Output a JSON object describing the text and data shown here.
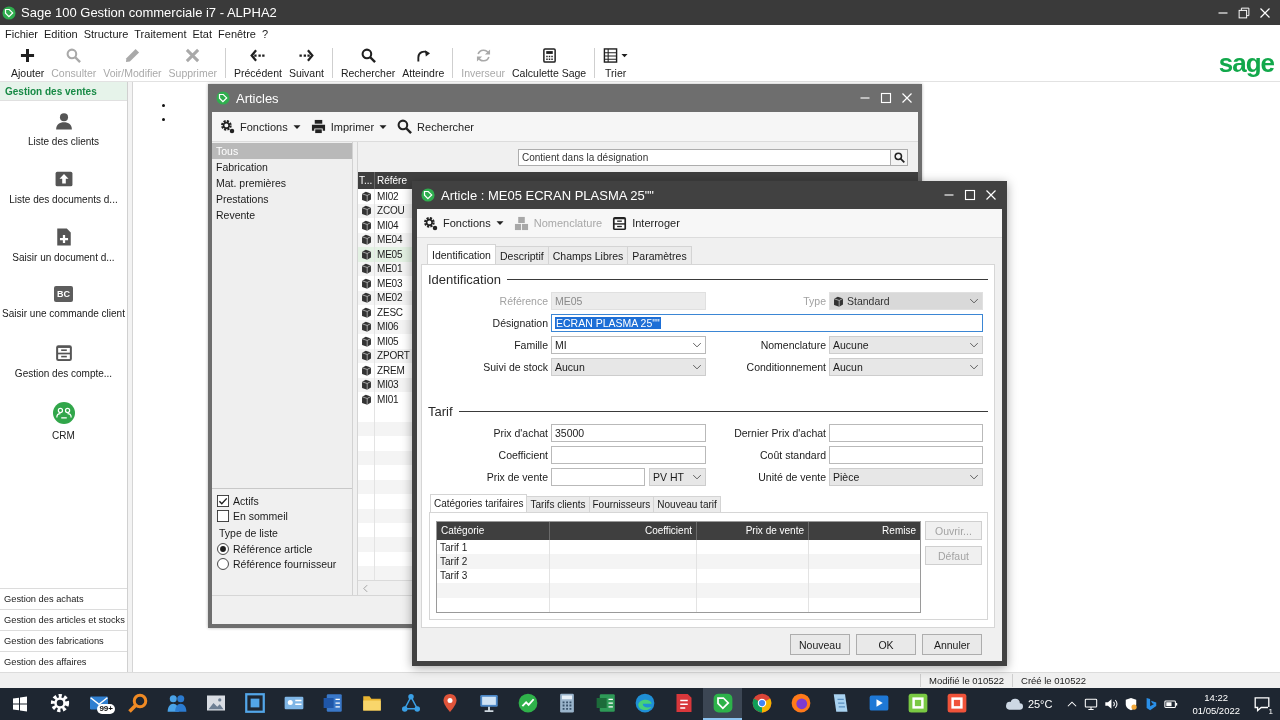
{
  "app": {
    "title": "Sage 100 Gestion commerciale i7 - ALPHA2",
    "logo": "sage"
  },
  "menu": [
    "Fichier",
    "Edition",
    "Structure",
    "Traitement",
    "Etat",
    "Fenêtre",
    "?"
  ],
  "toolbar": [
    [
      {
        "label": "Ajouter",
        "disabled": false,
        "dropdown": false
      },
      {
        "label": "Consulter",
        "disabled": true,
        "dropdown": false
      },
      {
        "label": "Voir/Modifier",
        "disabled": true,
        "dropdown": false
      },
      {
        "label": "Supprimer",
        "disabled": true,
        "dropdown": false
      }
    ],
    [
      {
        "label": "Précédent",
        "disabled": false,
        "dropdown": false
      },
      {
        "label": "Suivant",
        "disabled": false,
        "dropdown": false
      }
    ],
    [
      {
        "label": "Rechercher",
        "disabled": false,
        "dropdown": false
      },
      {
        "label": "Atteindre",
        "disabled": false,
        "dropdown": false
      }
    ],
    [
      {
        "label": "Inverseur",
        "disabled": true,
        "dropdown": false
      },
      {
        "label": "Calculette Sage",
        "disabled": false,
        "dropdown": false
      }
    ],
    [
      {
        "label": "Trier",
        "disabled": false,
        "dropdown": true
      }
    ]
  ],
  "sidebar": {
    "sections": [
      {
        "label": "Gestion des ventes",
        "selected": true,
        "items": [
          {
            "label": "Liste des clients"
          },
          {
            "label": "Liste des documents d..."
          },
          {
            "label": "Saisir un document d..."
          },
          {
            "label": "Saisir une commande client",
            "badge": "BC"
          },
          {
            "label": "Gestion des compte..."
          },
          {
            "label": "CRM"
          }
        ]
      },
      {
        "label": "Gestion des achats",
        "selected": false
      },
      {
        "label": "Gestion des articles et stocks",
        "selected": false
      },
      {
        "label": "Gestion des fabrications",
        "selected": false
      },
      {
        "label": "Gestion des affaires",
        "selected": false
      }
    ]
  },
  "articles_window": {
    "title": "Articles",
    "toolbar": [
      {
        "label": "Fonctions",
        "dropdown": true
      },
      {
        "label": "Imprimer",
        "dropdown": true
      },
      {
        "label": "Rechercher",
        "dropdown": false
      }
    ],
    "families": [
      {
        "label": "Tous",
        "selected": true
      },
      {
        "label": "Fabrication",
        "selected": false
      },
      {
        "label": "Mat. premières",
        "selected": false
      },
      {
        "label": "Prestations",
        "selected": false
      },
      {
        "label": "Revente",
        "selected": false
      }
    ],
    "filters": [
      {
        "label": "Actifs",
        "checked": true
      },
      {
        "label": "En sommeil",
        "checked": false
      }
    ],
    "list_type": {
      "label": "Type de liste",
      "options": [
        {
          "label": "Référence article",
          "selected": true
        },
        {
          "label": "Référence fournisseur",
          "selected": false
        }
      ]
    },
    "search": {
      "placeholder": "Contient dans la désignation"
    },
    "table": {
      "columns": [
        "T...",
        "Référe"
      ],
      "rows": [
        {
          "reference": "MI02",
          "selected": false
        },
        {
          "reference": "ZCOU",
          "selected": false
        },
        {
          "reference": "MI04",
          "selected": false
        },
        {
          "reference": "ME04",
          "selected": false
        },
        {
          "reference": "ME05",
          "selected": true
        },
        {
          "reference": "ME01",
          "selected": false
        },
        {
          "reference": "ME03",
          "selected": false
        },
        {
          "reference": "ME02",
          "selected": false
        },
        {
          "reference": "ZESC",
          "selected": false
        },
        {
          "reference": "MI06",
          "selected": false
        },
        {
          "reference": "MI05",
          "selected": false
        },
        {
          "reference": "ZPORT",
          "selected": false
        },
        {
          "reference": "ZREM",
          "selected": false
        },
        {
          "reference": "MI03",
          "selected": false
        },
        {
          "reference": "MI01",
          "selected": false
        }
      ]
    }
  },
  "article_dialog": {
    "title": "Article : ME05 ECRAN PLASMA 25\"\"",
    "toolbar": [
      {
        "label": "Fonctions",
        "disabled": false,
        "dropdown": true
      },
      {
        "label": "Nomenclature",
        "disabled": true,
        "dropdown": false
      },
      {
        "label": "Interroger",
        "disabled": false,
        "dropdown": false
      }
    ],
    "tabs": [
      {
        "label": "Identification",
        "selected": true
      },
      {
        "label": "Descriptif",
        "selected": false
      },
      {
        "label": "Champs Libres",
        "selected": false
      },
      {
        "label": "Paramètres",
        "selected": false
      }
    ],
    "sections": [
      {
        "title": "Identification",
        "fields": [
          {
            "label": "Référence",
            "kind": "text",
            "value": "ME05",
            "disabled": true,
            "focused": false
          },
          {
            "label": "Type",
            "kind": "item_type",
            "value": "Standard",
            "disabled": true,
            "focused": false
          },
          {
            "label": "Désignation",
            "kind": "long_text",
            "value": "ECRAN PLASMA 25\"\"",
            "disabled": false,
            "focused": true
          },
          {
            "label": "Famille",
            "kind": "combo",
            "value": "MI",
            "disabled": false,
            "focused": false
          },
          {
            "label": "Nomenclature",
            "kind": "select",
            "value": "Aucune",
            "disabled": false,
            "focused": false
          },
          {
            "label": "Suivi de stock",
            "kind": "select",
            "value": "Aucun",
            "disabled": false,
            "focused": false
          },
          {
            "label": "Conditionnement",
            "kind": "select",
            "value": "Aucun",
            "disabled": false,
            "focused": false
          }
        ]
      },
      {
        "title": "Tarif",
        "fields": [
          {
            "label": "Prix d'achat",
            "kind": "text",
            "value": "35000",
            "disabled": false,
            "focused": false
          },
          {
            "label": "Dernier Prix d'achat",
            "kind": "text",
            "disabled": false,
            "focused": false
          },
          {
            "label": "Coefficient",
            "kind": "text",
            "disabled": false,
            "focused": false
          },
          {
            "label": "Coût standard",
            "kind": "text",
            "disabled": false,
            "focused": false
          },
          {
            "label": "Prix de vente",
            "kind": "text",
            "unit": "PV HT",
            "disabled": false,
            "focused": false
          },
          {
            "label": "Unité de vente",
            "kind": "select",
            "value": "Pièce",
            "disabled": false,
            "focused": false
          }
        ]
      }
    ],
    "price_tabs": [
      {
        "label": "Catégories tarifaires",
        "selected": true
      },
      {
        "label": "Tarifs clients",
        "selected": false
      },
      {
        "label": "Fournisseurs",
        "selected": false
      },
      {
        "label": "Nouveau tarif",
        "selected": false
      }
    ],
    "price_table": {
      "columns": [
        "Catégorie",
        "Coefficient",
        "Prix de vente",
        "Remise"
      ],
      "rows": [
        {
          "category": "Tarif 1"
        },
        {
          "category": "Tarif 2"
        },
        {
          "category": "Tarif 3"
        }
      ]
    },
    "side_buttons": [
      {
        "label": "Ouvrir...",
        "disabled": true
      },
      {
        "label": "Défaut",
        "disabled": true
      }
    ],
    "buttons": [
      "Nouveau",
      "OK",
      "Annuler"
    ]
  },
  "status_bar": [
    "Modifié le 010522",
    "Créé le 010522"
  ],
  "taskbar": {
    "apps": [
      {
        "selected": false
      },
      {
        "selected": false,
        "badge": "99+"
      },
      {
        "selected": false
      },
      {
        "selected": false
      },
      {
        "selected": false
      },
      {
        "selected": false
      },
      {
        "selected": false
      },
      {
        "selected": false
      },
      {
        "selected": false
      },
      {
        "selected": false
      },
      {
        "selected": false
      },
      {
        "selected": false
      },
      {
        "selected": false
      },
      {
        "selected": false
      },
      {
        "selected": false
      },
      {
        "selected": false
      },
      {
        "selected": false
      },
      {
        "selected": true
      },
      {
        "selected": false
      },
      {
        "selected": false
      },
      {
        "selected": false
      },
      {
        "selected": false
      },
      {
        "selected": false
      },
      {
        "selected": false
      }
    ],
    "weather": "25°C",
    "time": "14:22",
    "date": "01/05/2022",
    "notifications": "1"
  }
}
